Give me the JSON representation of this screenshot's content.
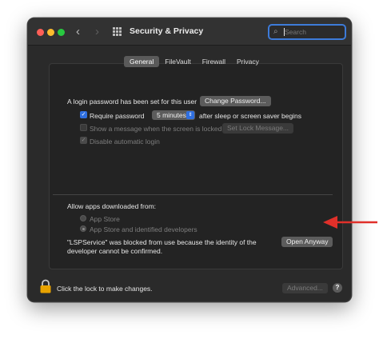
{
  "window": {
    "title": "Security & Privacy",
    "back_icon": "chevron-left-icon",
    "forward_icon": "chevron-right-icon",
    "grid_icon": "grid-icon"
  },
  "search": {
    "placeholder": "Search",
    "value": ""
  },
  "tabs": [
    {
      "label": "General",
      "active": true
    },
    {
      "label": "FileVault",
      "active": false
    },
    {
      "label": "Firewall",
      "active": false
    },
    {
      "label": "Privacy",
      "active": false
    }
  ],
  "general": {
    "login_text": "A login password has been set for this user",
    "change_password_button": "Change Password...",
    "require_password_label": "Require password",
    "require_password_checked": true,
    "require_password_value": "5 minutes",
    "require_password_suffix": "after sleep or screen saver begins",
    "show_message_label": "Show a message when the screen is locked",
    "show_message_checked": false,
    "set_lock_message_button": "Set Lock Message...",
    "disable_login_label": "Disable automatic login",
    "disable_login_checked": true
  },
  "apps": {
    "heading": "Allow apps downloaded from:",
    "options": [
      {
        "label": "App Store",
        "selected": false
      },
      {
        "label": "App Store and identified developers",
        "selected": true
      }
    ],
    "blocked_line1": "\"LSPService\" was blocked from use because the identity of the",
    "blocked_line2": "developer cannot be confirmed.",
    "open_anyway_button": "Open Anyway"
  },
  "footer": {
    "lock_text": "Click the lock to make changes.",
    "advanced_button": "Advanced...",
    "help_label": "?"
  },
  "colors": {
    "accent": "#2f6fe0",
    "annotation_arrow": "#e0302a",
    "window_bg": "#2a2a2a"
  }
}
